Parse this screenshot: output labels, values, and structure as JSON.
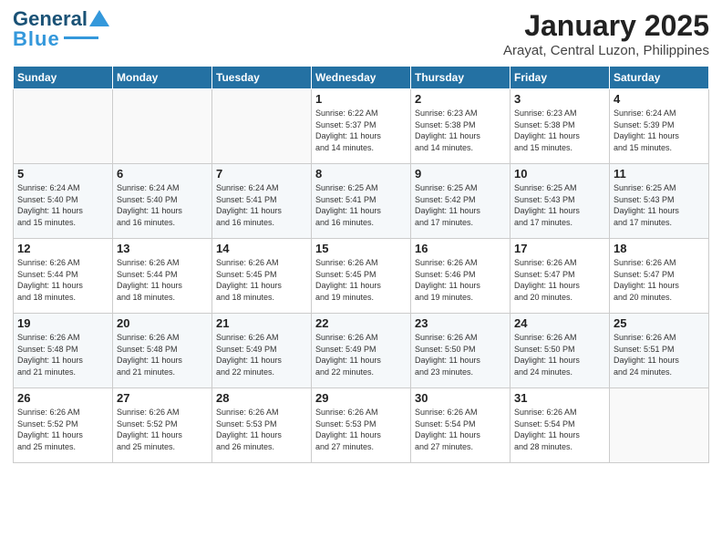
{
  "logo": {
    "text1": "General",
    "text2": "Blue"
  },
  "header": {
    "title": "January 2025",
    "subtitle": "Arayat, Central Luzon, Philippines"
  },
  "days_of_week": [
    "Sunday",
    "Monday",
    "Tuesday",
    "Wednesday",
    "Thursday",
    "Friday",
    "Saturday"
  ],
  "weeks": [
    [
      {
        "day": "",
        "info": ""
      },
      {
        "day": "",
        "info": ""
      },
      {
        "day": "",
        "info": ""
      },
      {
        "day": "1",
        "info": "Sunrise: 6:22 AM\nSunset: 5:37 PM\nDaylight: 11 hours\nand 14 minutes."
      },
      {
        "day": "2",
        "info": "Sunrise: 6:23 AM\nSunset: 5:38 PM\nDaylight: 11 hours\nand 14 minutes."
      },
      {
        "day": "3",
        "info": "Sunrise: 6:23 AM\nSunset: 5:38 PM\nDaylight: 11 hours\nand 15 minutes."
      },
      {
        "day": "4",
        "info": "Sunrise: 6:24 AM\nSunset: 5:39 PM\nDaylight: 11 hours\nand 15 minutes."
      }
    ],
    [
      {
        "day": "5",
        "info": "Sunrise: 6:24 AM\nSunset: 5:40 PM\nDaylight: 11 hours\nand 15 minutes."
      },
      {
        "day": "6",
        "info": "Sunrise: 6:24 AM\nSunset: 5:40 PM\nDaylight: 11 hours\nand 16 minutes."
      },
      {
        "day": "7",
        "info": "Sunrise: 6:24 AM\nSunset: 5:41 PM\nDaylight: 11 hours\nand 16 minutes."
      },
      {
        "day": "8",
        "info": "Sunrise: 6:25 AM\nSunset: 5:41 PM\nDaylight: 11 hours\nand 16 minutes."
      },
      {
        "day": "9",
        "info": "Sunrise: 6:25 AM\nSunset: 5:42 PM\nDaylight: 11 hours\nand 17 minutes."
      },
      {
        "day": "10",
        "info": "Sunrise: 6:25 AM\nSunset: 5:43 PM\nDaylight: 11 hours\nand 17 minutes."
      },
      {
        "day": "11",
        "info": "Sunrise: 6:25 AM\nSunset: 5:43 PM\nDaylight: 11 hours\nand 17 minutes."
      }
    ],
    [
      {
        "day": "12",
        "info": "Sunrise: 6:26 AM\nSunset: 5:44 PM\nDaylight: 11 hours\nand 18 minutes."
      },
      {
        "day": "13",
        "info": "Sunrise: 6:26 AM\nSunset: 5:44 PM\nDaylight: 11 hours\nand 18 minutes."
      },
      {
        "day": "14",
        "info": "Sunrise: 6:26 AM\nSunset: 5:45 PM\nDaylight: 11 hours\nand 18 minutes."
      },
      {
        "day": "15",
        "info": "Sunrise: 6:26 AM\nSunset: 5:45 PM\nDaylight: 11 hours\nand 19 minutes."
      },
      {
        "day": "16",
        "info": "Sunrise: 6:26 AM\nSunset: 5:46 PM\nDaylight: 11 hours\nand 19 minutes."
      },
      {
        "day": "17",
        "info": "Sunrise: 6:26 AM\nSunset: 5:47 PM\nDaylight: 11 hours\nand 20 minutes."
      },
      {
        "day": "18",
        "info": "Sunrise: 6:26 AM\nSunset: 5:47 PM\nDaylight: 11 hours\nand 20 minutes."
      }
    ],
    [
      {
        "day": "19",
        "info": "Sunrise: 6:26 AM\nSunset: 5:48 PM\nDaylight: 11 hours\nand 21 minutes."
      },
      {
        "day": "20",
        "info": "Sunrise: 6:26 AM\nSunset: 5:48 PM\nDaylight: 11 hours\nand 21 minutes."
      },
      {
        "day": "21",
        "info": "Sunrise: 6:26 AM\nSunset: 5:49 PM\nDaylight: 11 hours\nand 22 minutes."
      },
      {
        "day": "22",
        "info": "Sunrise: 6:26 AM\nSunset: 5:49 PM\nDaylight: 11 hours\nand 22 minutes."
      },
      {
        "day": "23",
        "info": "Sunrise: 6:26 AM\nSunset: 5:50 PM\nDaylight: 11 hours\nand 23 minutes."
      },
      {
        "day": "24",
        "info": "Sunrise: 6:26 AM\nSunset: 5:50 PM\nDaylight: 11 hours\nand 24 minutes."
      },
      {
        "day": "25",
        "info": "Sunrise: 6:26 AM\nSunset: 5:51 PM\nDaylight: 11 hours\nand 24 minutes."
      }
    ],
    [
      {
        "day": "26",
        "info": "Sunrise: 6:26 AM\nSunset: 5:52 PM\nDaylight: 11 hours\nand 25 minutes."
      },
      {
        "day": "27",
        "info": "Sunrise: 6:26 AM\nSunset: 5:52 PM\nDaylight: 11 hours\nand 25 minutes."
      },
      {
        "day": "28",
        "info": "Sunrise: 6:26 AM\nSunset: 5:53 PM\nDaylight: 11 hours\nand 26 minutes."
      },
      {
        "day": "29",
        "info": "Sunrise: 6:26 AM\nSunset: 5:53 PM\nDaylight: 11 hours\nand 27 minutes."
      },
      {
        "day": "30",
        "info": "Sunrise: 6:26 AM\nSunset: 5:54 PM\nDaylight: 11 hours\nand 27 minutes."
      },
      {
        "day": "31",
        "info": "Sunrise: 6:26 AM\nSunset: 5:54 PM\nDaylight: 11 hours\nand 28 minutes."
      },
      {
        "day": "",
        "info": ""
      }
    ]
  ]
}
